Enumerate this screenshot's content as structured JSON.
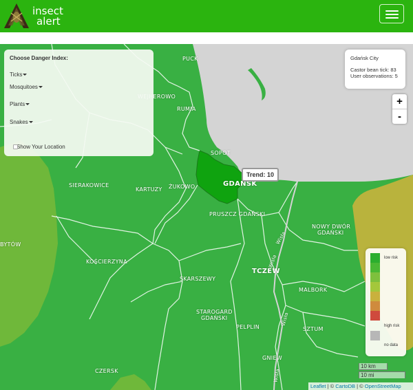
{
  "app": {
    "logo_line1": "insect",
    "logo_line2": "alert",
    "menu_icon": "hamburger-menu-icon"
  },
  "panel": {
    "title": "Choose Danger Index:",
    "dropdowns": [
      "Ticks",
      "Mosquitoes",
      "Plants",
      "Snakes"
    ],
    "show_location_label": "Show Your Location"
  },
  "info": {
    "city": "Gdańsk City",
    "line1": "Castor bean tick: 83",
    "line2": "User observations: 5"
  },
  "zoom": {
    "in": "+",
    "out": "-"
  },
  "tooltip": {
    "text": "Trend: 10"
  },
  "places": {
    "puck": "PUCK",
    "wejherowo": "WEJHEROWO",
    "rumia": "RUMIA",
    "sopot": "SOPOT",
    "gdansk": "GDAŃSK",
    "sierakowice": "SIERAKOWICE",
    "kartuzy": "KARTUZY",
    "zukowo": "ŻUKOWO",
    "pruszcz": "PRUSZCZ GDAŃSKI",
    "nowy_dwor": "NOWY DWÓR",
    "nowy_dwor2": "GDAŃSKI",
    "bytow": "BYTÓW",
    "koscierzyna": "KOŚCIERZYNA",
    "tczew": "TCZEW",
    "skarszewy": "SKARSZEWY",
    "malbork": "MALBORK",
    "starogard": "STAROGARD",
    "starogard2": "GDAŃSKI",
    "pelplin": "PELPLIN",
    "sztum": "SZTUM",
    "gniew": "GNIEW",
    "czersk": "CZERSK",
    "wisla1": "Wisła",
    "wisla2": "Wisła",
    "wisla3": "Wisła",
    "wisla4": "Wisła"
  },
  "legend": {
    "low": "low risk",
    "high": "high risk",
    "nodata": "no data",
    "colors": [
      "#2bae2e",
      "#4ab834",
      "#7ec03d",
      "#a4c73b",
      "#c9b13d",
      "#cf8b3d",
      "#cf4a3d",
      "#b7b7b7"
    ]
  },
  "scale": {
    "km": "10 km",
    "mi": "10 mi"
  },
  "attribution": {
    "leaflet": "Leaflet",
    "sep1": " | © ",
    "carto": "CartoDB",
    "sep2": " | © ",
    "osm": "OpenStreetMap"
  },
  "colors": {
    "brand": "#2bb40f",
    "region_default": "#39b043",
    "region_highlight": "#0fa30f",
    "region_light": "#6fb83a",
    "region_olive": "#b9b33d",
    "water": "#d4d4d4"
  }
}
